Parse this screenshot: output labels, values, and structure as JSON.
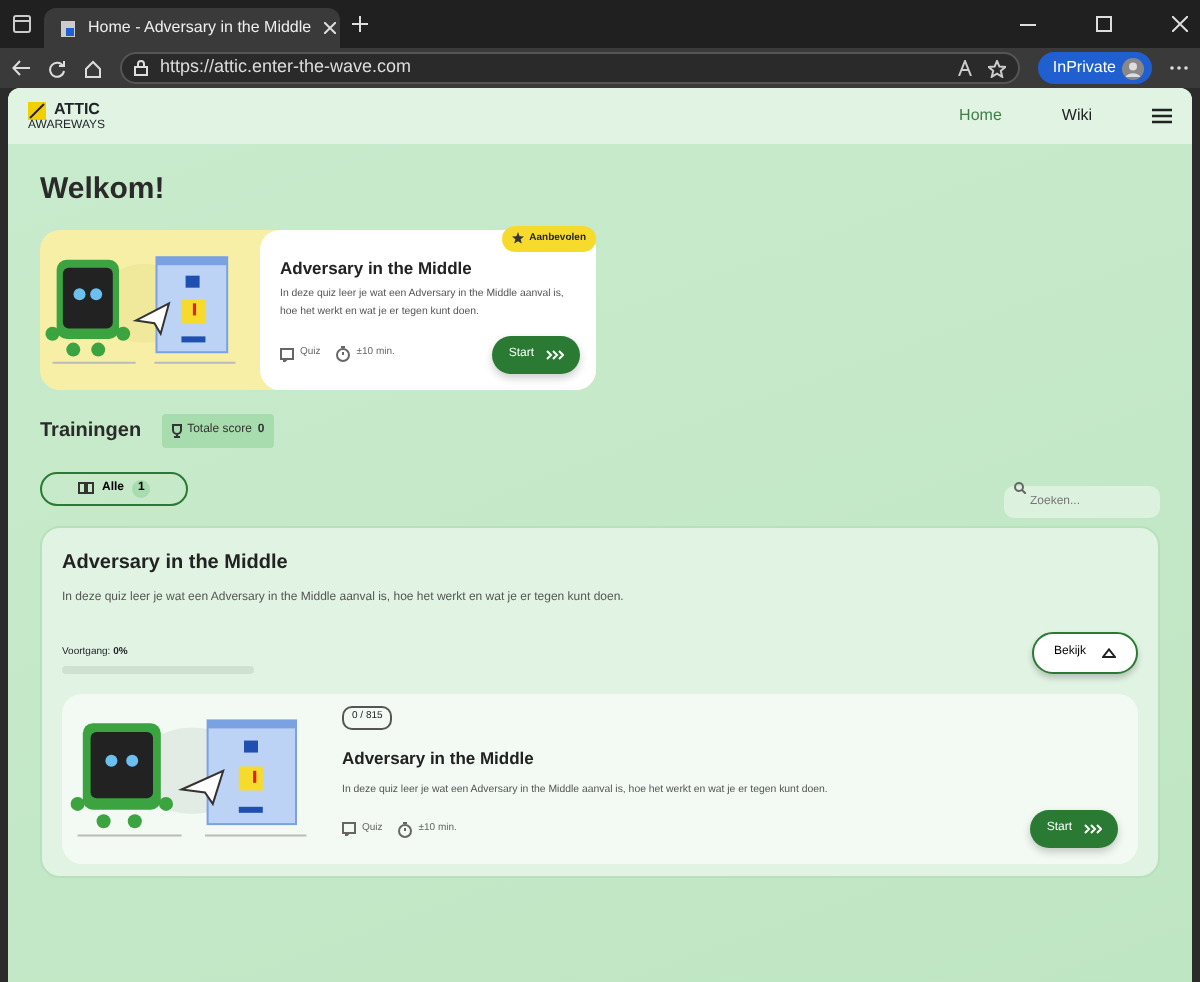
{
  "browser": {
    "tab_title": "Home - Adversary in the Middle",
    "url": "https://attic.enter-the-wave.com",
    "profile_label": "InPrivate"
  },
  "navbar": {
    "logo_text": "ATTIC",
    "logo_subtext": "AWAREWAYS",
    "links": [
      {
        "label": "Home",
        "selected": true
      },
      {
        "label": "Wiki",
        "selected": false
      }
    ]
  },
  "heading": "Welkom!",
  "featured": {
    "badge": "Aanbevolen",
    "title": "Adversary in the Middle",
    "description": "In deze quiz leer je wat een Adversary in the Middle aanval is, hoe het werkt en wat je er tegen kunt doen.",
    "meta": [
      {
        "kind": "type",
        "text": "Quiz"
      },
      {
        "kind": "duration",
        "text": "±10 min."
      }
    ],
    "start": "Start"
  },
  "trainingen": {
    "title": "Trainingen",
    "score_label": "Totale score",
    "score_value": "0"
  },
  "filters": [
    {
      "label": "Alle",
      "count": "1",
      "selected": true
    }
  ],
  "search": {
    "placeholder": "Zoeken..."
  },
  "course": {
    "title": "Adversary in the Middle",
    "description": "In deze quiz leer je wat een Adversary in the Middle aanval is, hoe het werkt en wat je er tegen kunt doen.",
    "progress_label": "Voortgang:",
    "progress_value": "0%",
    "level": 0,
    "toggle": "Bekijk",
    "expanded": true,
    "module": {
      "counter": "0 / 815",
      "title": "Adversary in the Middle",
      "description": "In deze quiz leer je wat een Adversary in the Middle aanval is, hoe het werkt en wat je er tegen kunt doen.",
      "meta": [
        {
          "kind": "type",
          "text": "Quiz"
        },
        {
          "kind": "duration",
          "text": "±10 min."
        }
      ],
      "start": "Start"
    }
  }
}
